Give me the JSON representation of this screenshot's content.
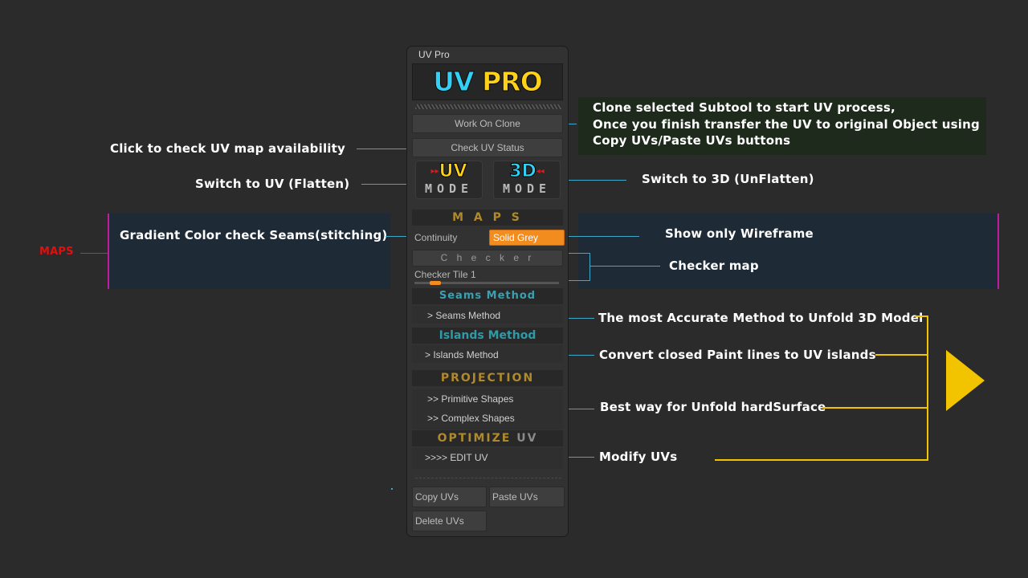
{
  "panel": {
    "title": "UV Pro",
    "logo": {
      "uv": "UV",
      "pro": "PRO"
    },
    "work_on_clone": "Work On Clone",
    "check_uv_status": "Check UV Status",
    "uv_mode": {
      "big": "UV",
      "small": "MODE"
    },
    "mode_3d": {
      "big": "3D",
      "small": "MODE"
    },
    "maps_header": "M A P S",
    "continuity": "Continuity",
    "solid_grey": "Solid Grey",
    "checker": "C h e c k e r",
    "checker_tile_label": "Checker Tile",
    "checker_tile_value": "1",
    "checker_tile_level": 0.1,
    "seams_header": "Seams Method",
    "seams_item": "> Seams Method",
    "islands_header": "Islands Method",
    "islands_item": ">  Islands Method",
    "projection_header": "PROJECTION",
    "primitive_shapes": ">> Primitive Shapes",
    "complex_shapes": ">> Complex Shapes",
    "optimize_header_a": "OPTIMIZE",
    "optimize_header_b": "UV",
    "edit_uv": ">>>> EDIT UV",
    "copy_uvs": "Copy UVs",
    "paste_uvs": "Paste UVs",
    "delete_uvs": "Delete UVs"
  },
  "annotations": {
    "clone_line1": "Clone selected Subtool to start UV process,",
    "clone_line2": "Once you finish transfer the UV to original Object using",
    "clone_line3": "Copy UVs/Paste UVs buttons",
    "check_uv": "Click to check UV map availability",
    "switch_uv": "Switch to UV (Flatten)",
    "switch_3d": "Switch to 3D (UnFlatten)",
    "maps_tag": "MAPS",
    "gradient": "Gradient Color check Seams(stitching)",
    "wireframe": "Show only Wireframe",
    "checker_map": "Checker map",
    "accurate": "The most Accurate Method to Unfold 3D Model",
    "paint_lines": "Convert closed Paint lines to UV islands",
    "hardsurface": "Best way for Unfold hardSurface",
    "modify": "Modify UVs"
  },
  "colors": {
    "background": "#2b2b2b",
    "accent_orange": "#f28c1e",
    "accent_cyan": "#3fa8c8",
    "accent_yellow": "#f2c400",
    "maps_red": "#e01010",
    "section_teal": "#3aa0b0",
    "section_gold": "#b08a2a"
  },
  "icons": [
    "play-arrow-icon",
    "red-arrows-icon"
  ]
}
